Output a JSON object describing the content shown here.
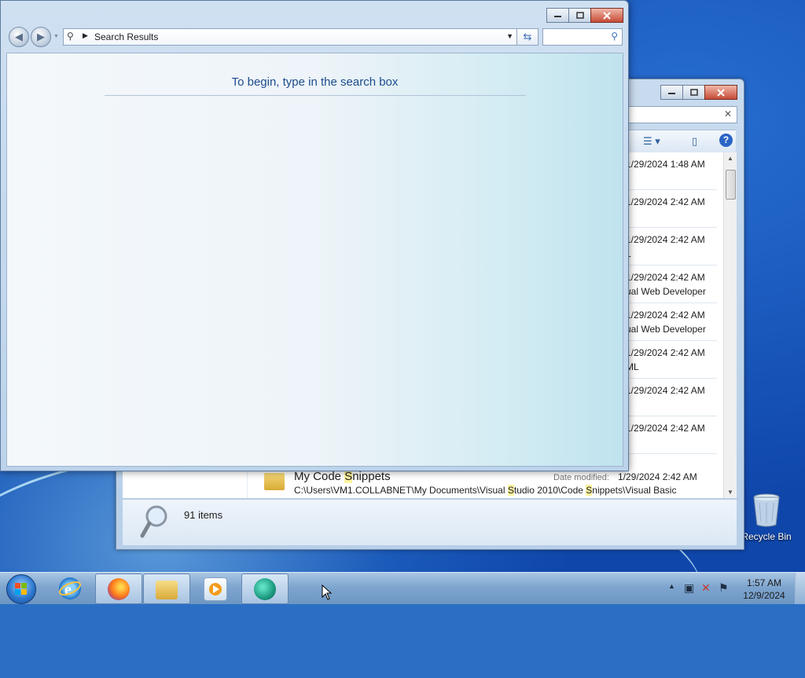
{
  "front_window": {
    "address_crumb": "Search Results",
    "search_placeholder": "",
    "hint": "To begin, type in the search box",
    "caption_buttons": [
      "minimize",
      "maximize",
      "close"
    ]
  },
  "back_window": {
    "rows": [
      {
        "date": "1/29/2024 1:48 AM",
        "sub": ""
      },
      {
        "date": "1/29/2024 2:42 AM",
        "sub": ""
      },
      {
        "date": "1/29/2024 2:42 AM",
        "sub": "L"
      },
      {
        "date": "1/29/2024 2:42 AM",
        "sub": "ual Web Developer"
      },
      {
        "date": "1/29/2024 2:42 AM",
        "sub": "ual Web Developer"
      },
      {
        "date": "1/29/2024 2:42 AM",
        "sub": "ML"
      },
      {
        "date": "1/29/2024 2:42 AM",
        "sub": ""
      },
      {
        "date": "1/29/2024 2:42 AM",
        "sub": ""
      }
    ],
    "last_row": {
      "name_pre": "My Code ",
      "name_hl": "S",
      "name_post": "nippets",
      "date_label": "Date modified:",
      "date_value": "1/29/2024 2:42 AM",
      "path_1": "C:\\Users\\VM1.COLLABNET\\My Documents\\Visual ",
      "path_hl1": "S",
      "path_2": "tudio 2010\\Code ",
      "path_hl2": "S",
      "path_3": "nippets\\Visual Basic"
    },
    "items_count": "91 items"
  },
  "desktop": {
    "recycle_bin_label": "Recycle Bin"
  },
  "taskbar": {
    "apps": [
      "internet-explorer",
      "firefox",
      "windows-explorer",
      "media-player",
      "app-green"
    ],
    "time": "1:57 AM",
    "date": "12/9/2024"
  },
  "colors": {
    "hint_text": "#1c4c8c",
    "highlight": "#fff4a0",
    "close_button": "#c64a35"
  }
}
